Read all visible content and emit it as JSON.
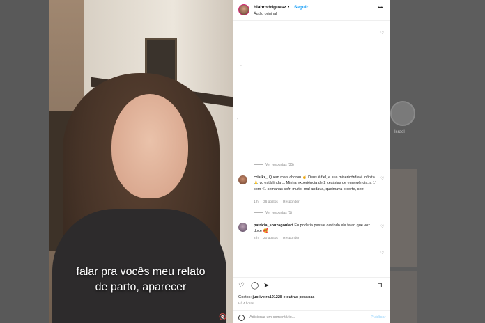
{
  "background": {
    "story_label": "Israel"
  },
  "video": {
    "caption_line1": "falar pra vocês meu relato",
    "caption_line2": "de parto, aparecer",
    "mute_icon": "speaker-muted-icon"
  },
  "post": {
    "username": "biahrodriguesz",
    "dot": "•",
    "follow_label": "Seguir",
    "audio_label": "Áudio original",
    "more_icon": "more-horizontal-icon"
  },
  "comments": {
    "view_replies_1": "Ver respostas (35)",
    "view_replies_2": "Ver respostas (1)",
    "items": [
      {
        "user": "crisikz_",
        "text": "Quem mais chorou 🤞 Deus é fiel, e sua misericórdia é infinita 🙏 vc está linda ... Minha experiência de 2 cesárias de emergência, a 1° com 41 semanas sofri muito, mal andava, queimava o corte, sent",
        "time": "1 h",
        "likes": "36 gostos",
        "reply": "Responder"
      },
      {
        "user": "patricia_souzagoulart",
        "text": "Eu poderia passar ouvindo ela falar, que voz doce 🥰",
        "time": "2 h",
        "likes": "20 gostos",
        "reply": "Responder"
      }
    ]
  },
  "actions": {
    "like_icon": "heart-icon",
    "comment_icon": "comment-icon",
    "share_icon": "send-icon",
    "save_icon": "bookmark-icon"
  },
  "likes": {
    "prefix": "Gostos:",
    "user": "juoliveira101228",
    "suffix": "e outras pessoas"
  },
  "posted_ago": "Há 4 horas",
  "composer": {
    "placeholder": "Adicionar um comentário...",
    "publish_label": "Publicar"
  }
}
